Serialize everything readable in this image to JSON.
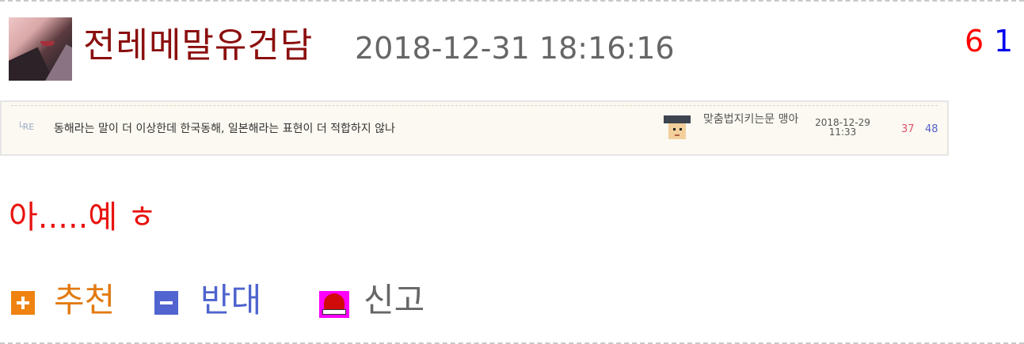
{
  "post": {
    "author": "전레메말유건담",
    "date": "2018-12-31 18:16:16",
    "upvotes": "6",
    "downvotes": "1",
    "message": "아.....예 ㅎ"
  },
  "referenced_post": {
    "re_icon": "RE",
    "title": "동해라는 말이 더 이상한데 한국동해, 일본해라는 표현이 더 적합하지 않나",
    "author": "맞춤법지키는문 맹아",
    "date_line1": "2018-12-29",
    "date_line2": "11:33",
    "upvotes": "37",
    "downvotes": "48"
  },
  "actions": {
    "recommend_label": "추천",
    "oppose_label": "반대",
    "report_label": "신고"
  },
  "colors": {
    "author": "#8b0f0f",
    "message": "#e8130f",
    "upvote": "#ff0000",
    "downvote": "#0000ee",
    "recommend": "#e27a12",
    "oppose": "#4e63cd",
    "report_icon_bg": "#ff00ff"
  },
  "icons": {
    "avatar": "user-avatar",
    "recommend": "plus-icon",
    "oppose": "minus-icon",
    "report": "siren-icon",
    "ref_author": "user-face-icon",
    "reply": "reply-icon"
  }
}
